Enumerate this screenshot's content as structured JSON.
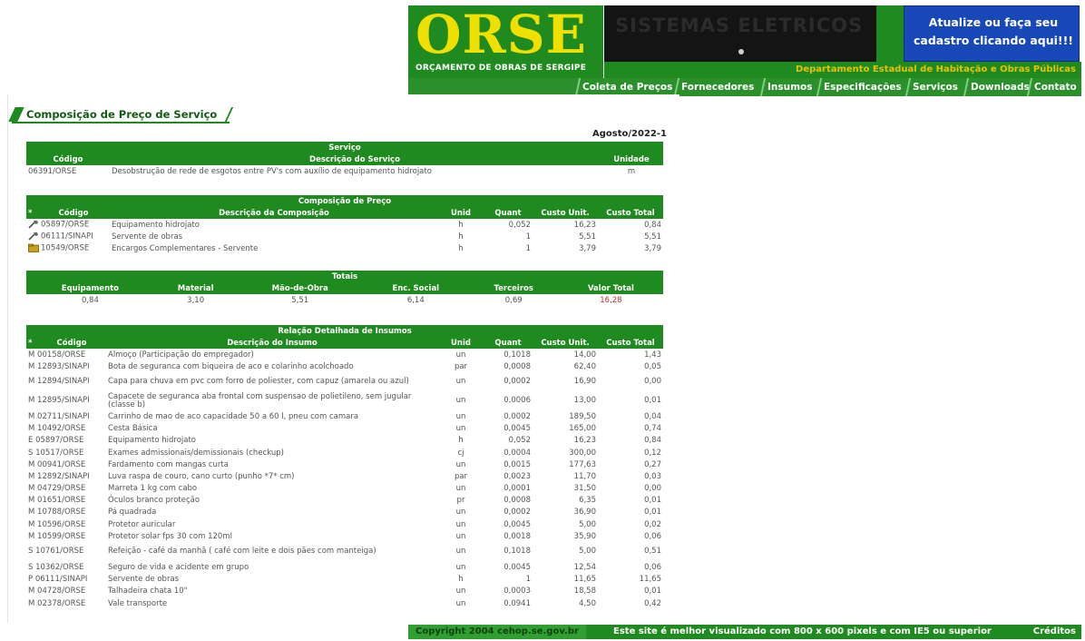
{
  "header": {
    "logo": "ORSE",
    "logo_subtitle": "ORÇAMENTO DE OBRAS DE SERGIPE",
    "banner": "SISTEMAS ELETRICOS",
    "cta": "Atualize ou faça seu cadastro clicando aqui!!!",
    "department": "Departamento Estadual de Habitação e Obras Públicas",
    "nav": [
      "Coleta de Preços",
      "Fornecedores",
      "Insumos",
      "Especificações",
      "Serviços",
      "Downloads",
      "Contato"
    ]
  },
  "page": {
    "title": "Composição de Preço de Serviço",
    "period": "Agosto/2022-1"
  },
  "servico": {
    "section_title": "Serviço",
    "headers": [
      "Código",
      "Descrição do Serviço",
      "Unidade"
    ],
    "row": [
      "06391/ORSE",
      "Desobstrução de rede de esgotos entre PV's com auxílio de equipamento hidrojato",
      "m"
    ]
  },
  "composicao": {
    "section_title": "Composição de Preço",
    "headers": [
      "*",
      "Código",
      "Descrição da Composição",
      "Unid",
      "Quant",
      "Custo Unit.",
      "Custo Total"
    ],
    "rows": [
      {
        "icon": "hammer-icon",
        "codigo": "05897/ORSE",
        "descricao": "Equipamento hidrojato",
        "unid": "h",
        "quant": "0,052",
        "custo_unit": "16,23",
        "custo_total": "0,84"
      },
      {
        "icon": "hammer-icon",
        "codigo": "06111/SINAPI",
        "descricao": "Servente de obras",
        "unid": "h",
        "quant": "1",
        "custo_unit": "5,51",
        "custo_total": "5,51"
      },
      {
        "icon": "folder-icon",
        "codigo": "10549/ORSE",
        "descricao": "Encargos Complementares - Servente",
        "unid": "h",
        "quant": "1",
        "custo_unit": "3,79",
        "custo_total": "3,79"
      }
    ]
  },
  "totais": {
    "section_title": "Totais",
    "headers": [
      "Equipamento",
      "Material",
      "Mão-de-Obra",
      "Enc. Social",
      "Terceiros",
      "Valor Total"
    ],
    "values": [
      "0,84",
      "3,10",
      "5,51",
      "6,14",
      "0,69",
      "16,28"
    ]
  },
  "insumos": {
    "section_title": "Relação Detalhada de Insumos",
    "headers": [
      "*",
      "Código",
      "Descrição do Insumo",
      "Unid",
      "Quant",
      "Custo Unit.",
      "Custo Total"
    ],
    "rows": [
      {
        "codigo": "M 00158/ORSE",
        "descricao": "Almoço (Participação do empregador)",
        "unid": "un",
        "quant": "0,1018",
        "custo_unit": "14,00",
        "custo_total": "1,43"
      },
      {
        "codigo": "M 12893/SINAPI",
        "descricao": "Bota de seguranca com biqueira de aco e colarinho acolchoado",
        "unid": "par",
        "quant": "0,0008",
        "custo_unit": "62,40",
        "custo_total": "0,05"
      },
      {
        "codigo": "M 12894/SINAPI",
        "descricao": "Capa para chuva em pvc com forro de poliester, com capuz (amarela ou azul)",
        "unid": "un",
        "quant": "0,0002",
        "custo_unit": "16,90",
        "custo_total": "0,00"
      },
      {
        "codigo": "M 12895/SINAPI",
        "descricao": "Capacete de seguranca aba frontal com suspensao de polietileno, sem jugular (classe b)",
        "unid": "un",
        "quant": "0,0006",
        "custo_unit": "13,00",
        "custo_total": "0,01"
      },
      {
        "codigo": "M 02711/SINAPI",
        "descricao": "Carrinho de mao de aco capacidade 50 a 60 l, pneu com camara",
        "unid": "un",
        "quant": "0,0002",
        "custo_unit": "189,50",
        "custo_total": "0,04"
      },
      {
        "codigo": "M 10492/ORSE",
        "descricao": "Cesta Básica",
        "unid": "un",
        "quant": "0,0045",
        "custo_unit": "165,00",
        "custo_total": "0,74"
      },
      {
        "codigo": "E 05897/ORSE",
        "descricao": "Equipamento hidrojato",
        "unid": "h",
        "quant": "0,052",
        "custo_unit": "16,23",
        "custo_total": "0,84"
      },
      {
        "codigo": "S 10517/ORSE",
        "descricao": "Exames admissionais/demissionais (checkup)",
        "unid": "cj",
        "quant": "0,0004",
        "custo_unit": "300,00",
        "custo_total": "0,12"
      },
      {
        "codigo": "M 00941/ORSE",
        "descricao": "Fardamento com mangas curta",
        "unid": "un",
        "quant": "0,0015",
        "custo_unit": "177,63",
        "custo_total": "0,27"
      },
      {
        "codigo": "M 12892/SINAPI",
        "descricao": "Luva raspa de couro, cano curto (punho *7* cm)",
        "unid": "par",
        "quant": "0,0023",
        "custo_unit": "11,70",
        "custo_total": "0,03"
      },
      {
        "codigo": "M 04729/ORSE",
        "descricao": "Marreta 1 kg com cabo",
        "unid": "un",
        "quant": "0,0001",
        "custo_unit": "31,50",
        "custo_total": "0,00"
      },
      {
        "codigo": "M 01651/ORSE",
        "descricao": "Óculos branco proteção",
        "unid": "pr",
        "quant": "0,0008",
        "custo_unit": "6,35",
        "custo_total": "0,01"
      },
      {
        "codigo": "M 10788/ORSE",
        "descricao": "Pá quadrada",
        "unid": "un",
        "quant": "0,0002",
        "custo_unit": "36,90",
        "custo_total": "0,01"
      },
      {
        "codigo": "M 10596/ORSE",
        "descricao": "Protetor auricular",
        "unid": "un",
        "quant": "0,0045",
        "custo_unit": "5,00",
        "custo_total": "0,02"
      },
      {
        "codigo": "M 10599/ORSE",
        "descricao": "Protetor solar fps 30 com 120ml",
        "unid": "un",
        "quant": "0,0018",
        "custo_unit": "35,90",
        "custo_total": "0,06"
      },
      {
        "codigo": "S 10761/ORSE",
        "descricao": "Refeição - café da manhã ( café com leite e dois pães com manteiga)",
        "unid": "un",
        "quant": "0,1018",
        "custo_unit": "5,00",
        "custo_total": "0,51"
      },
      {
        "codigo": "S 10362/ORSE",
        "descricao": "Seguro de vida e acidente em grupo",
        "unid": "un",
        "quant": "0,0045",
        "custo_unit": "12,54",
        "custo_total": "0,06"
      },
      {
        "codigo": "P 06111/SINAPI",
        "descricao": "Servente de obras",
        "unid": "h",
        "quant": "1",
        "custo_unit": "11,65",
        "custo_total": "11,65"
      },
      {
        "codigo": "M 04728/ORSE",
        "descricao": "Talhadeira chata 10\"",
        "unid": "un",
        "quant": "0,0003",
        "custo_unit": "18,58",
        "custo_total": "0,01"
      },
      {
        "codigo": "M 02378/ORSE",
        "descricao": "Vale transporte",
        "unid": "un",
        "quant": "0,0941",
        "custo_unit": "4,50",
        "custo_total": "0,42"
      }
    ]
  },
  "footer": {
    "copyright": "Copyright 2004 cehop.se.gov.br",
    "best_viewed": "Este site é melhor visualizado com 800 x 600 pixels e com IE5 ou superior",
    "credits": "Créditos"
  }
}
